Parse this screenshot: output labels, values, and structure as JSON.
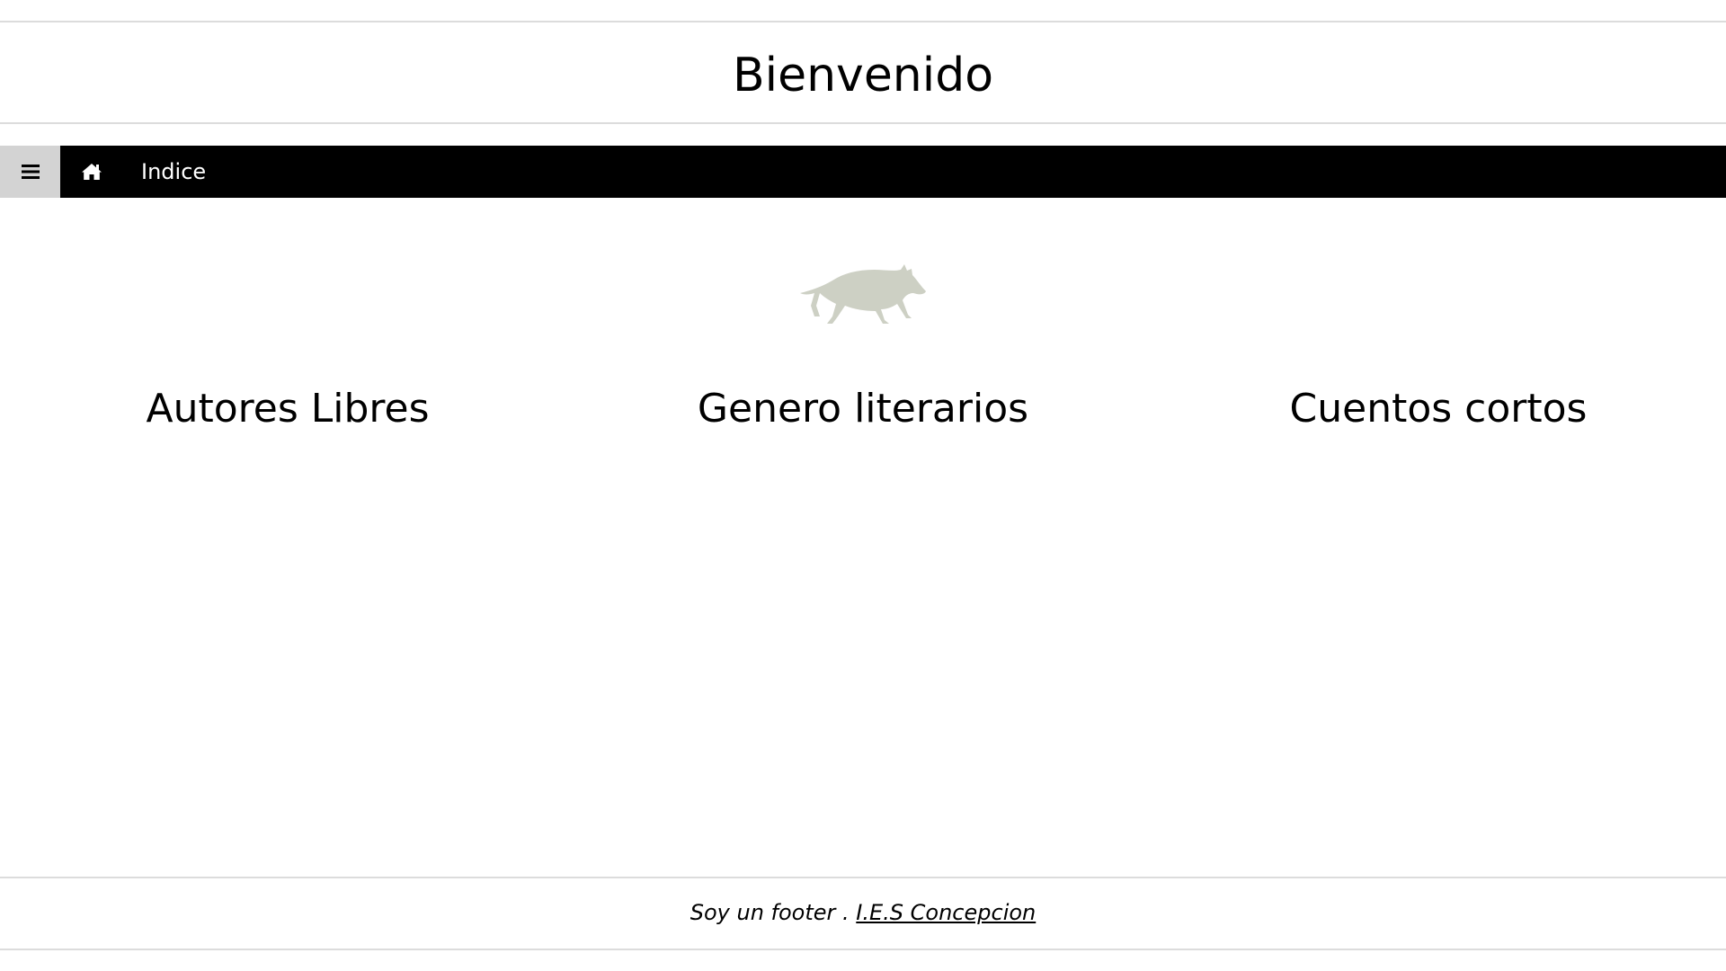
{
  "header": {
    "title": "Bienvenido"
  },
  "navbar": {
    "menu_icon": "hamburger-menu-icon",
    "home_icon": "home-icon",
    "link_label": "Indice",
    "background": "#000000",
    "menu_background": "#d3d3d3"
  },
  "logo": {
    "icon": "wolf-silhouette-icon",
    "color": "#cdd0c4"
  },
  "sections": [
    {
      "title": "Autores Libres"
    },
    {
      "title": "Genero literarios"
    },
    {
      "title": "Cuentos cortos"
    }
  ],
  "footer": {
    "text": "Soy un footer . ",
    "link_label": "I.E.S Concepcion"
  }
}
